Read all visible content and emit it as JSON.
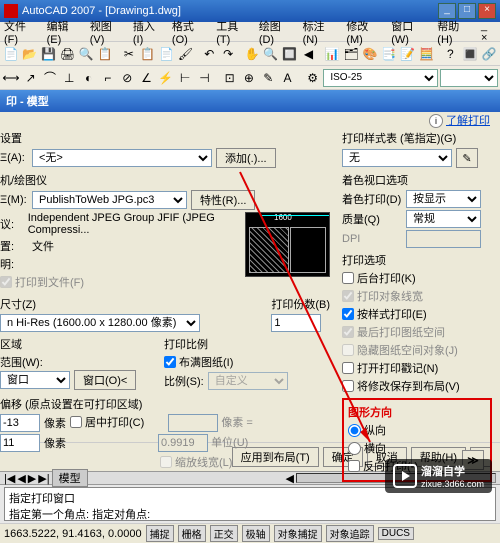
{
  "app": {
    "title": "AutoCAD 2007 - [Drawing1.dwg]"
  },
  "menu": [
    "文件(F)",
    "编辑(E)",
    "视图(V)",
    "插入(I)",
    "格式(O)",
    "工具(T)",
    "绘图(D)",
    "标注(N)",
    "修改(M)",
    "窗口(W)",
    "帮助(H)"
  ],
  "toolbar2": {
    "combo1": "ISO-25",
    "combo2": ""
  },
  "dialog": {
    "title": "印 - 模型",
    "learn_link": "了解打印",
    "page_setup": {
      "label": "设置",
      "name_label": "Ξ(A):",
      "value": "<无>",
      "add_btn": "添加(.)..."
    },
    "style_table": {
      "label": "打印样式表 (笔指定)(G)",
      "value": "无"
    },
    "printer": {
      "label": "机/绘图仪",
      "name_label": "Ξ(M):",
      "value": "PublishToWeb JPG.pc3",
      "props_btn": "特性(R)...",
      "plotter_label": "议:",
      "plotter_value": "Independent JPEG Group JFIF (JPEG Compressi...",
      "where_label": "置:",
      "where_value": "文件",
      "desc_label": "明:",
      "to_file_chk": "打印到文件(F)"
    },
    "shade": {
      "label": "着色视口选项",
      "shade_label": "着色打印(D)",
      "shade_value": "按显示",
      "quality_label": "质量(Q)",
      "quality_value": "常规",
      "dpi_label": "DPI"
    },
    "options": {
      "label": "打印选项",
      "bg": "后台打印(K)",
      "lineweights": "打印对象线宽",
      "styles": "按样式打印(E)",
      "last": "最后打印图纸空间",
      "hide": "隐藏图纸空间对象(J)",
      "stamp": "打开打印戳记(N)",
      "save": "将修改保存到布局(V)"
    },
    "papersize": {
      "label": "尺寸(Z)",
      "value": "n Hi-Res (1600.00 x 1280.00 像素)"
    },
    "copies": {
      "label": "打印份数(B)",
      "value": "1"
    },
    "area": {
      "label": "区域",
      "what_label": "范围(W):",
      "value": "窗口",
      "window_btn": "窗口(O)<"
    },
    "scale": {
      "label": "打印比例",
      "fit_chk": "布满图纸(I)",
      "scale_label": "比例(S):",
      "scale_value": "自定义"
    },
    "offset": {
      "label": "偏移 (原点设置在可打印区域)",
      "x_label": "-13",
      "x_unit": "像素",
      "center_chk": "居中打印(C)",
      "y_label": "11",
      "y_unit": "像素",
      "unit_eq": "像素 =",
      "unit_val": "0.9919",
      "units_label": "单位(U)",
      "scale_lw": "缩放线宽(L)"
    },
    "orient": {
      "label": "图形方向",
      "portrait": "纵向",
      "landscape": "横向",
      "upside": "反向打印(-)"
    },
    "buttons": {
      "apply": "应用到布局(T)",
      "ok": "确定",
      "cancel": "取消",
      "help": "帮助(H)"
    },
    "preview_dim": "1600"
  },
  "cmd": {
    "line1": "指定打印窗口",
    "line2": "指定第一个角点: 指定对角点:"
  },
  "status": {
    "coords": "1663.5222, 91.4163, 0.0000",
    "btns": [
      "捕捉",
      "栅格",
      "正交",
      "极轴",
      "对象捕捉",
      "对象追踪",
      "DUCS"
    ]
  },
  "watermark": {
    "brand": "溜溜自学",
    "url": "zixue.3d66.com"
  },
  "scroll": {
    "tab1": "模型",
    "tab2": ""
  }
}
